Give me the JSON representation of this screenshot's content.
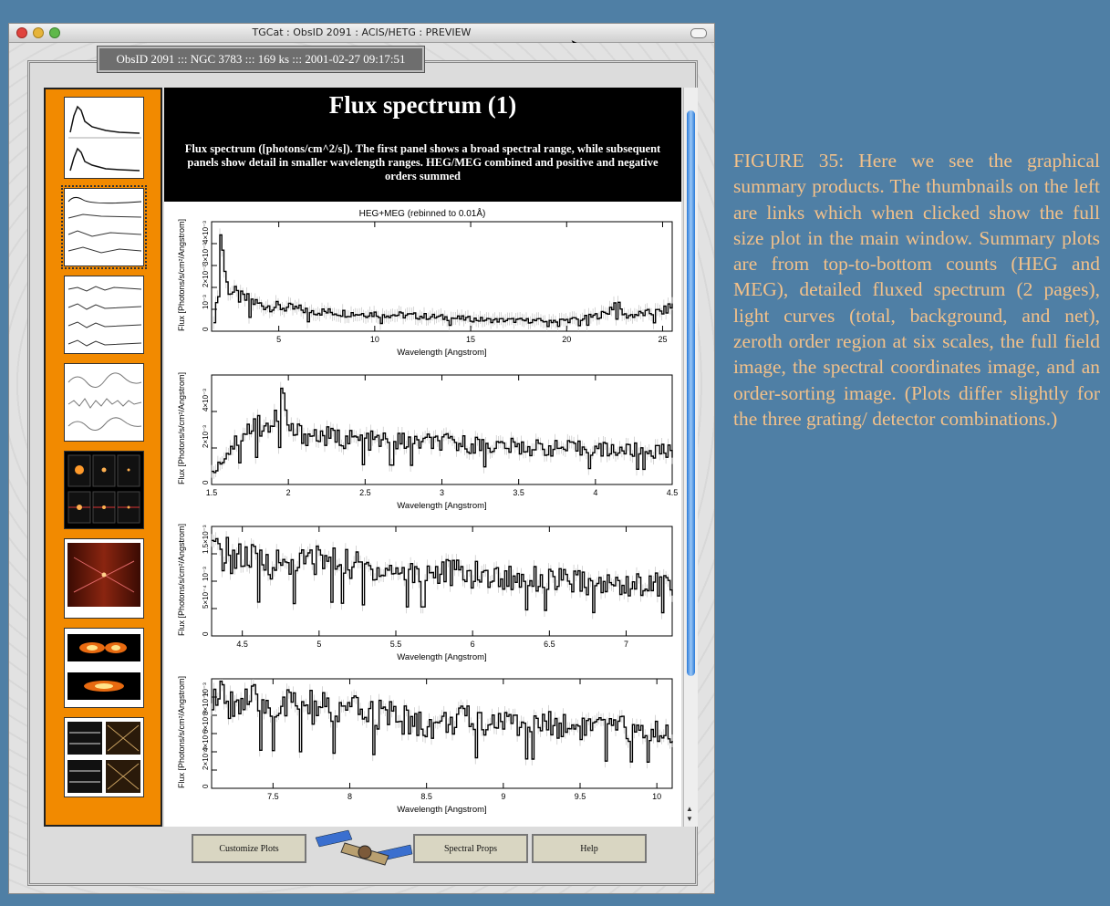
{
  "window": {
    "title": "TGCat : ObsID 2091 : ACIS/HETG : PREVIEW",
    "tab_label": "ObsID 2091 ::: NGC 3783 ::: 169 ks ::: 2001-02-27 09:17:51"
  },
  "header": {
    "title": "Flux spectrum (1)",
    "description": "Flux spectrum ([photons/cm^2/s]). The first panel shows a broad spectral range, while subsequent panels show detail in smaller wavelength ranges. HEG/MEG combined and positive and negative orders summed"
  },
  "plot_title": "HEG+MEG (rebinned to 0.01Å)",
  "chart_data": [
    {
      "type": "line",
      "title": "HEG+MEG (rebinned to 0.01Å)",
      "xlabel": "Wavelength [Angstrom]",
      "ylabel": "Flux [Photons/s/cm²/Angstrom]",
      "xlim": [
        1.5,
        25.5
      ],
      "ylim": [
        0,
        0.005
      ],
      "xticks": [
        5,
        10,
        15,
        20,
        25
      ],
      "yticks": [
        "0",
        "10⁻³",
        "2×10⁻³",
        "3×10⁻³",
        "4×10⁻³"
      ],
      "x": [
        1.6,
        1.8,
        1.95,
        2.2,
        2.5,
        3,
        3.5,
        4,
        5,
        6,
        7,
        8,
        9,
        10,
        11,
        12,
        13,
        14,
        15,
        16,
        17,
        18,
        19,
        20,
        21,
        22,
        22.5,
        23,
        24,
        25,
        25.5
      ],
      "y": [
        0.0005,
        0.0016,
        0.0048,
        0.0022,
        0.0018,
        0.0015,
        0.0014,
        0.0012,
        0.0011,
        0.001,
        0.0009,
        0.00085,
        0.0008,
        0.0008,
        0.00075,
        0.0007,
        0.00065,
        0.0006,
        0.00055,
        0.0005,
        0.0005,
        0.00048,
        0.00048,
        0.0005,
        0.0006,
        0.0008,
        0.0013,
        0.0007,
        0.0008,
        0.0009,
        0.0012
      ]
    },
    {
      "type": "line",
      "title": "",
      "xlabel": "Wavelength [Angstrom]",
      "ylabel": "Flux [Photons/s/cm²/Angstrom]",
      "xlim": [
        1.5,
        4.5
      ],
      "ylim": [
        0,
        0.005
      ],
      "xticks": [
        1.5,
        2,
        2.5,
        3,
        3.5,
        4,
        4.5
      ],
      "yticks": [
        "0",
        "2×10⁻³",
        "4×10⁻³"
      ],
      "x": [
        1.5,
        1.6,
        1.7,
        1.8,
        1.9,
        1.95,
        2,
        2.2,
        2.5,
        3,
        3.5,
        4,
        4.5
      ],
      "y": [
        0.0005,
        0.0015,
        0.0024,
        0.0028,
        0.0026,
        0.0042,
        0.0024,
        0.0022,
        0.002,
        0.0019,
        0.0017,
        0.0016,
        0.0015
      ]
    },
    {
      "type": "line",
      "title": "",
      "xlabel": "Wavelength [Angstrom]",
      "ylabel": "Flux [Photons/s/cm²/Angstrom]",
      "xlim": [
        4.3,
        7.3
      ],
      "ylim": [
        0,
        0.0017
      ],
      "xticks": [
        4.5,
        5,
        5.5,
        6,
        6.5,
        7
      ],
      "yticks": [
        "0",
        "5×10⁻⁴",
        "10⁻³",
        "1.5×10⁻³"
      ],
      "x": [
        4.3,
        4.5,
        4.8,
        5,
        5.2,
        5.5,
        5.8,
        6,
        6.2,
        6.4,
        6.6,
        6.8,
        7,
        7.3
      ],
      "y": [
        0.0013,
        0.0012,
        0.0011,
        0.0012,
        0.0011,
        0.001,
        0.001,
        0.00095,
        0.0009,
        0.0009,
        0.00085,
        0.0008,
        0.0008,
        0.0008
      ]
    },
    {
      "type": "line",
      "title": "",
      "xlabel": "Wavelength [Angstrom]",
      "ylabel": "Flux [Photons/s/cm²/Angstrom]",
      "xlim": [
        7.1,
        10.1
      ],
      "ylim": [
        0,
        0.00115
      ],
      "xticks": [
        7.5,
        8,
        8.5,
        9,
        9.5,
        10
      ],
      "yticks": [
        "0",
        "2×10⁻⁴",
        "4×10⁻⁴",
        "6×10⁻⁴",
        "8×10⁻⁴",
        "10⁻³"
      ],
      "x": [
        7.1,
        7.3,
        7.5,
        7.7,
        8,
        8.2,
        8.5,
        8.7,
        9,
        9.2,
        9.5,
        9.8,
        10.1
      ],
      "y": [
        0.00095,
        0.0009,
        0.00088,
        0.00085,
        0.0008,
        0.00078,
        0.00065,
        0.00072,
        0.0007,
        0.00068,
        0.00065,
        0.00062,
        0.0006
      ]
    }
  ],
  "buttons": {
    "customize": "Customize Plots",
    "spectral": "Spectral Props",
    "help": "Help"
  },
  "caption": "FIGURE 35: Here we see the graphical summary products. The thumbnails on the left are links which when clicked show the full size plot in the main window. Summary plots are from top-to-bottom counts (HEG and MEG), detailed fluxed spectrum (2 pages), light curves (total, background, and net), zeroth order region at six scales, the full field image, the spectral coordinates image, and an order-sorting image. (Plots differ slightly for the three grating/ detector combinations.)",
  "colors": {
    "background": "#4f7fa5",
    "sidebar": "#f28a00",
    "caption": "#f3c18a"
  }
}
